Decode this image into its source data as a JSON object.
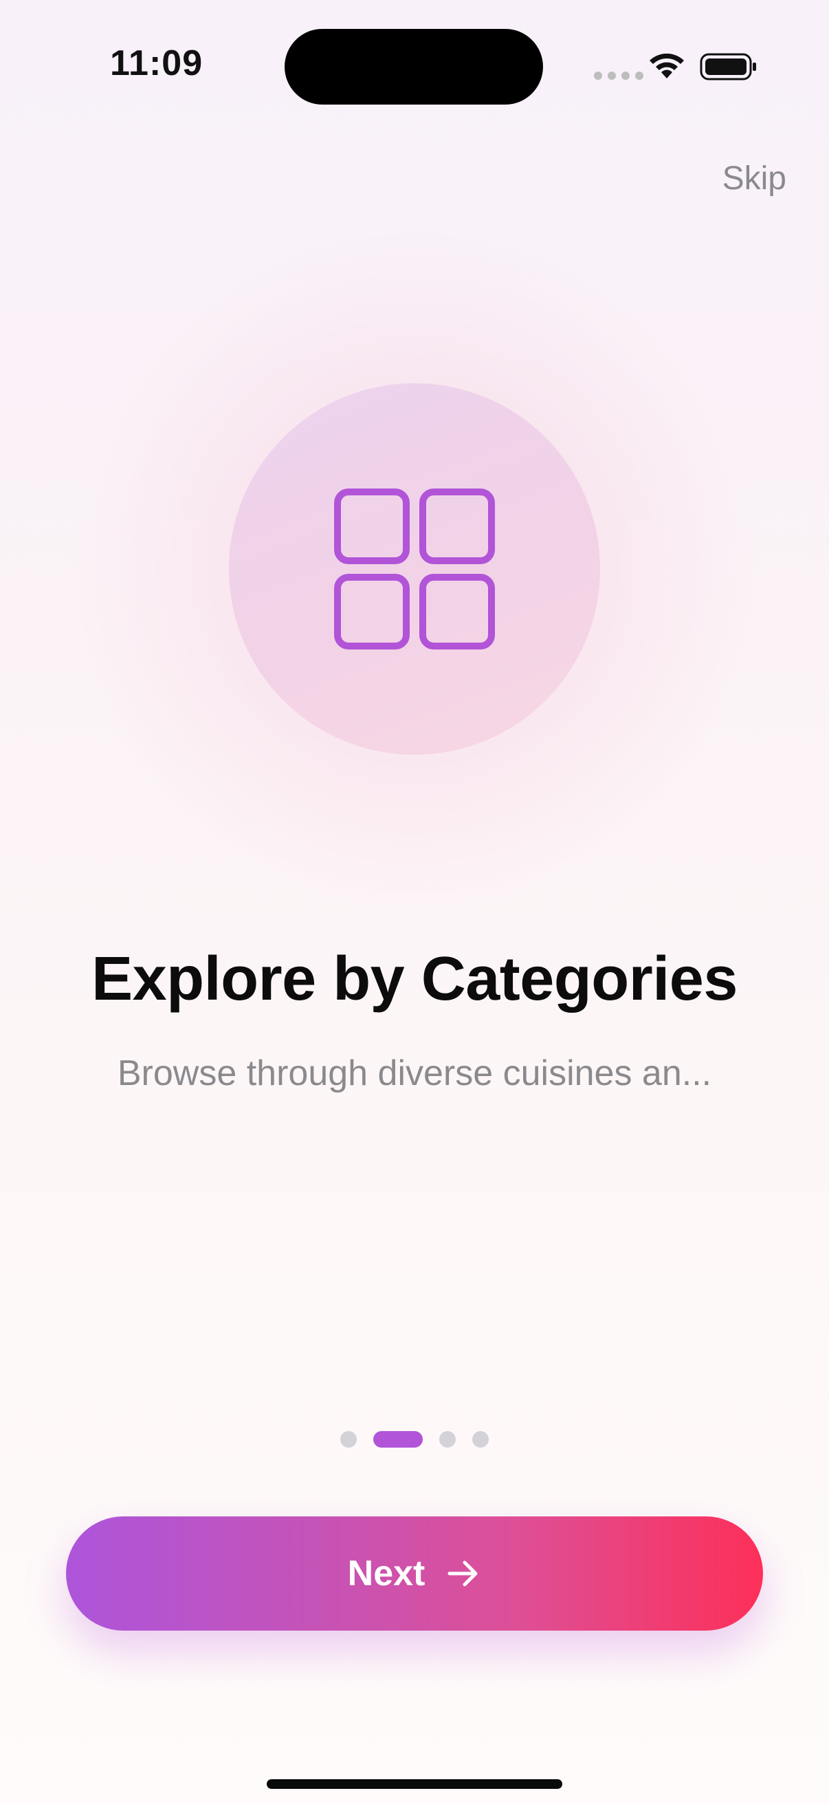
{
  "status_bar": {
    "time": "11:09",
    "wifi_icon": "wifi-icon",
    "battery_icon": "battery-icon"
  },
  "header": {
    "skip_label": "Skip"
  },
  "hero": {
    "icon": "grid-icon",
    "accent_color": "#b154d8"
  },
  "content": {
    "title": "Explore by Categories",
    "subtitle": "Browse through diverse cuisines an..."
  },
  "pagination": {
    "total": 4,
    "active_index": 1
  },
  "footer": {
    "next_label": "Next",
    "next_icon": "arrow-right-icon",
    "gradient_start": "#ad55db",
    "gradient_end": "#fd2f59"
  }
}
